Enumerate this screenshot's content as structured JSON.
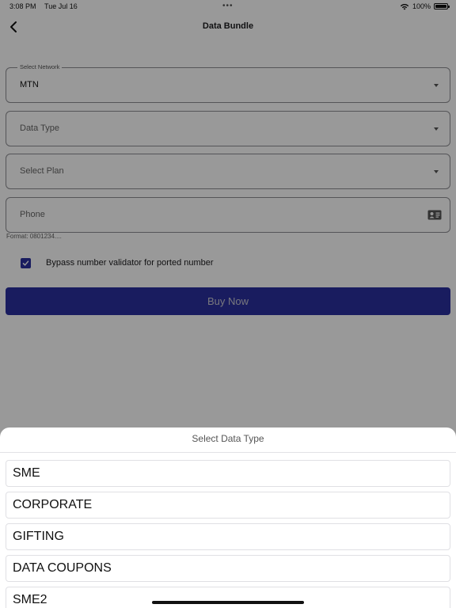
{
  "status_bar": {
    "time": "3:08 PM",
    "date": "Tue Jul 16",
    "dots": "•••",
    "battery": "100%"
  },
  "nav": {
    "title": "Data Bundle",
    "back_icon": "chevron-left-icon"
  },
  "form": {
    "network": {
      "label": "Select Network",
      "value": "MTN"
    },
    "data_type": {
      "placeholder": "Data Type"
    },
    "plan": {
      "placeholder": "Select Plan"
    },
    "phone": {
      "placeholder": "Phone",
      "hint": "Format: 0801234....",
      "icon": "contact-card-icon"
    },
    "bypass": {
      "checked": true,
      "label": "Bypass number validator for ported number"
    },
    "buy_label": "Buy Now"
  },
  "sheet": {
    "title": "Select Data Type",
    "options": [
      "SME",
      "CORPORATE",
      "GIFTING",
      "DATA COUPONS",
      "SME2"
    ]
  },
  "colors": {
    "accent": "#2b2f9e",
    "overlay": "rgba(0,0,0,0.4)"
  }
}
